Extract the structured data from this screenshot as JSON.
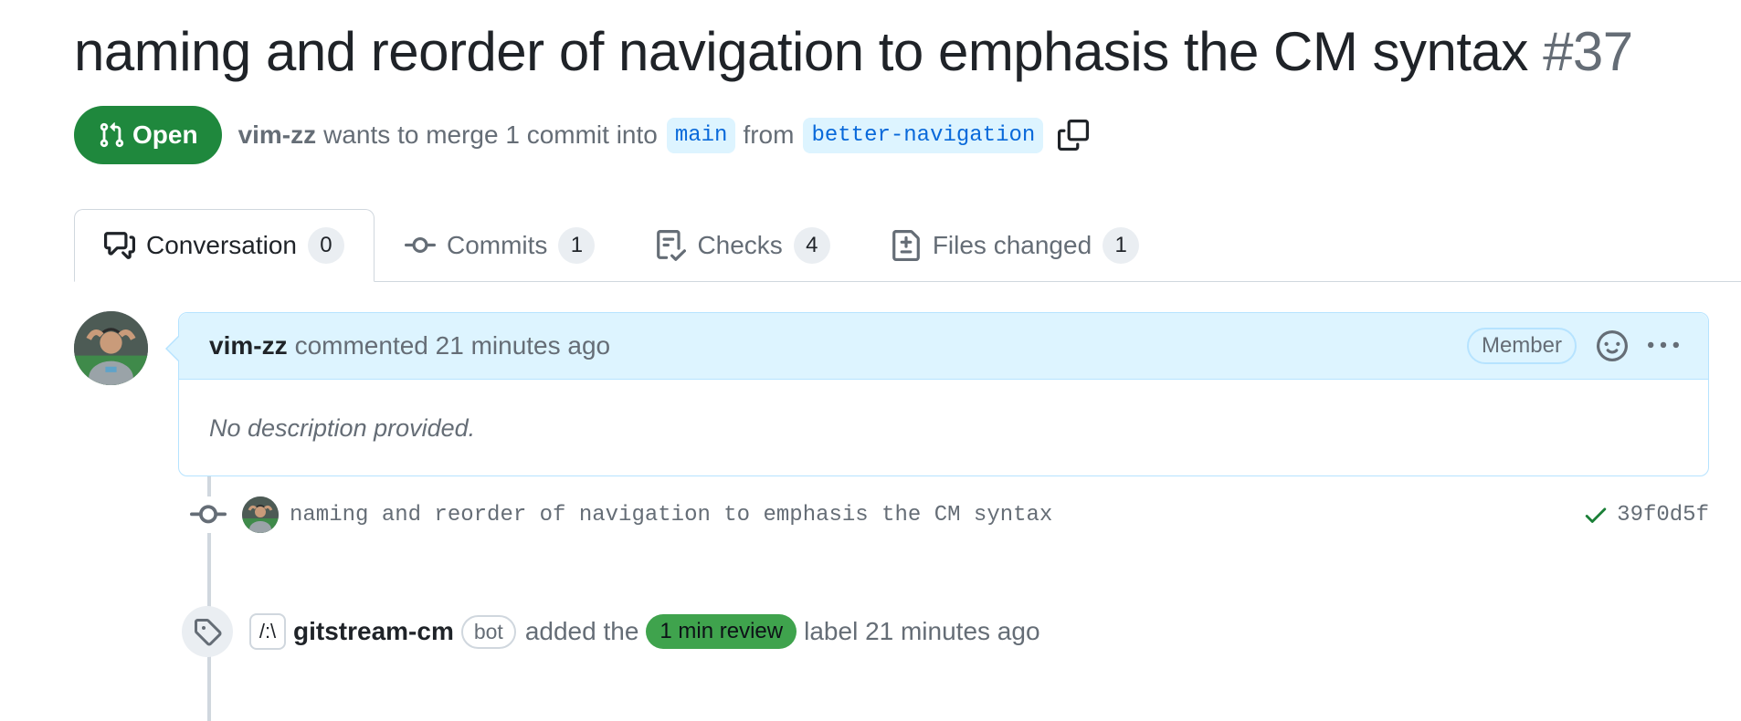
{
  "pr": {
    "title": "naming and reorder of navigation to emphasis the CM syntax",
    "number": "#37",
    "state": "Open",
    "author": "vim-zz",
    "merge_text_1": "wants to merge 1 commit into",
    "base_branch": "main",
    "merge_text_2": "from",
    "head_branch": "better-navigation"
  },
  "tabs": [
    {
      "label": "Conversation",
      "count": "0",
      "icon": "comment-discussion-icon"
    },
    {
      "label": "Commits",
      "count": "1",
      "icon": "git-commit-icon"
    },
    {
      "label": "Checks",
      "count": "4",
      "icon": "checklist-icon"
    },
    {
      "label": "Files changed",
      "count": "1",
      "icon": "file-diff-icon"
    }
  ],
  "comment": {
    "author": "vim-zz",
    "action": "commented 21 minutes ago",
    "role_badge": "Member",
    "body": "No description provided."
  },
  "commit": {
    "message": "naming and reorder of navigation to emphasis the CM syntax",
    "sha": "39f0d5f",
    "status": "success"
  },
  "label_event": {
    "bot_avatar_text": "/:\\",
    "actor": "gitstream-cm",
    "actor_badge": "bot",
    "text_before": "added the",
    "label": "1 min review",
    "text_after": "label 21 minutes ago"
  },
  "colors": {
    "open_green": "#1f883d",
    "branch_blue": "#0969da",
    "branch_bg": "#ddf4ff",
    "comment_header_bg": "#ddf4ff",
    "label_green": "#3fa34d"
  }
}
